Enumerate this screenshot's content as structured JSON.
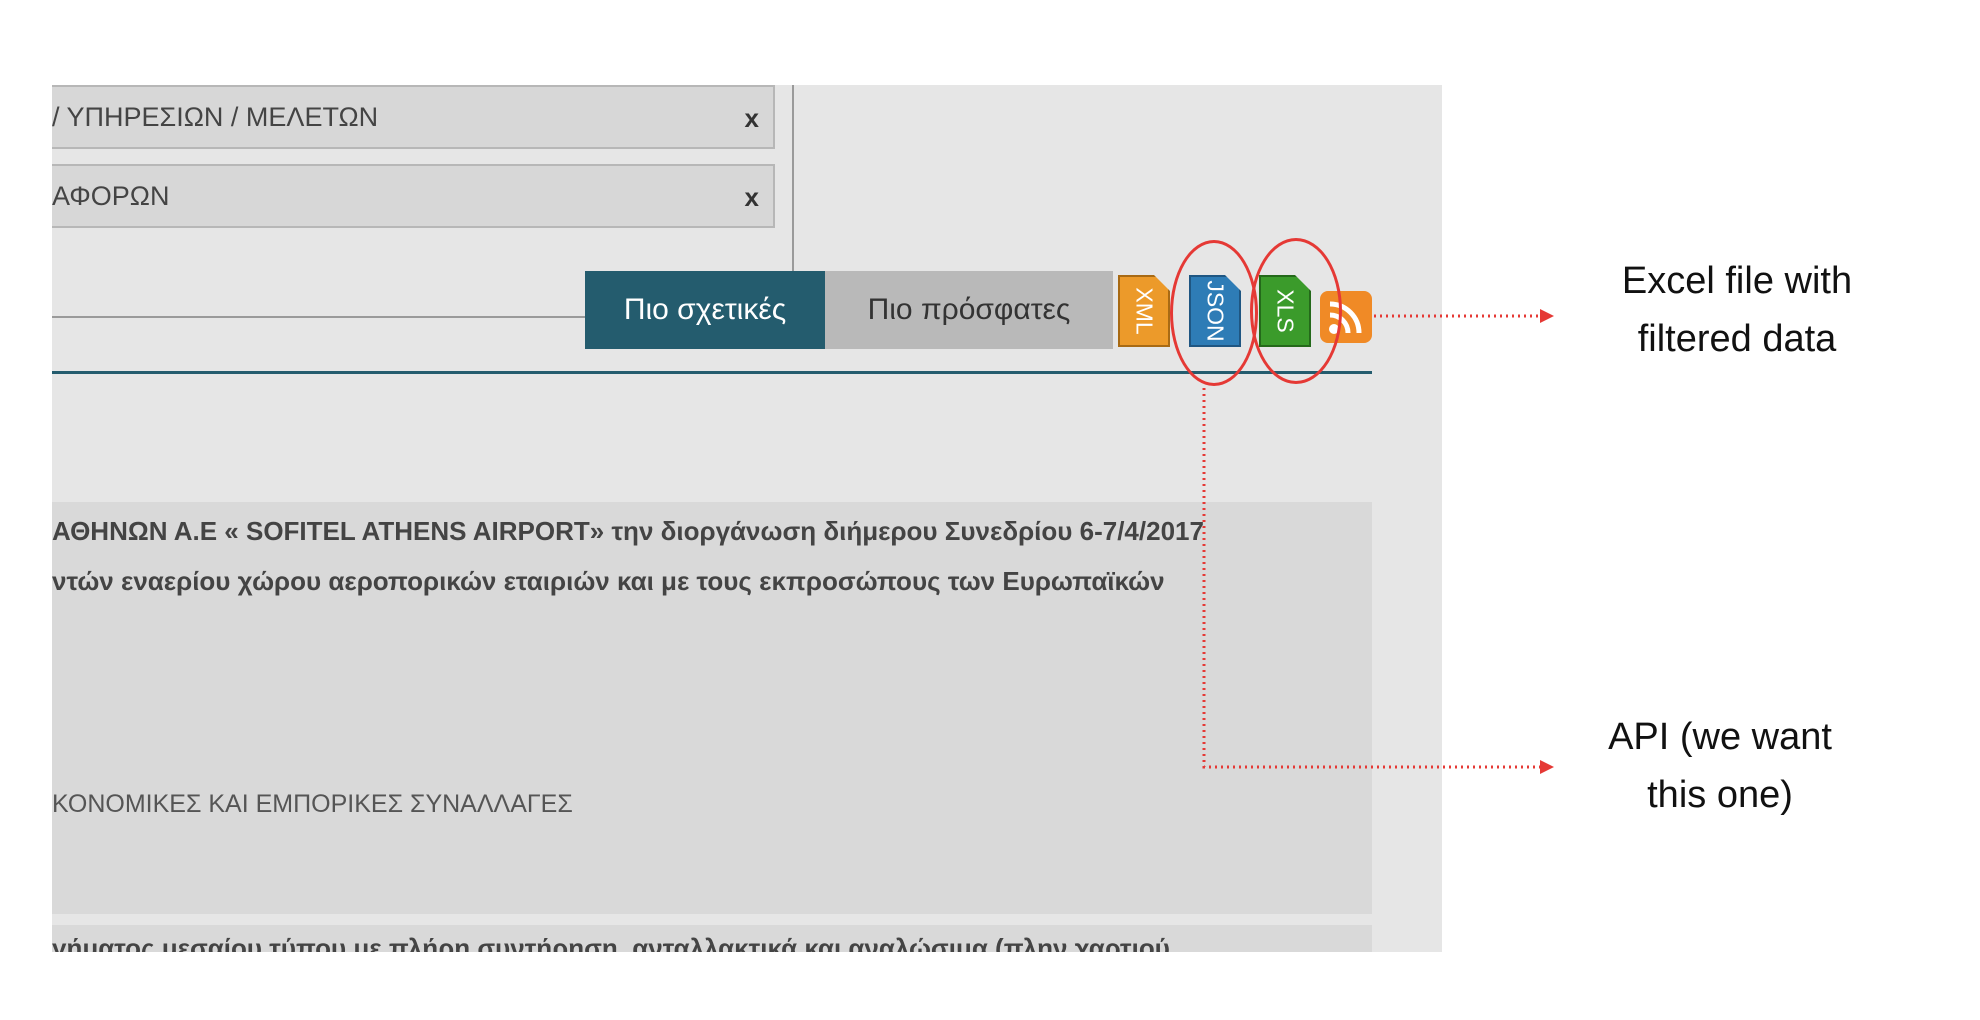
{
  "filters": {
    "chips": [
      {
        "label": "/ ΥΠΗΡΕΣΙΩΝ / ΜΕΛΕΤΩΝ",
        "remove": "x"
      },
      {
        "label": "ΑΦΟΡΩΝ",
        "remove": "x"
      }
    ]
  },
  "sort_tabs": {
    "active": "Πιο σχετικές",
    "inactive": "Πιο πρόσφατες"
  },
  "export_icons": {
    "xml": "XML",
    "json": "JSON",
    "xls": "XLS",
    "rss": "rss-icon"
  },
  "result": {
    "line1": "ΑΘΗΝΩΝ Α.Ε « SOFITEL ATHENS AIRPORT» την διοργάνωση διήμερου Συνεδρίου 6-7/4/2017",
    "line2": "ντών εναερίου χώρου αεροπορικών εταιριών και με τους εκπροσώπους των Ευρωπαϊκών",
    "category": "ΚΟΝΟΜΙΚΕΣ ΚΑΙ ΕΜΠΟΡΙΚΕΣ ΣΥΝΑΛΛΑΓΕΣ",
    "next_line": "γήματος μεσαίου τύπου με πλήρη συντήρηση, ανταλλακτικά και αναλώσιμα (πλην χαρτιού"
  },
  "annotations": {
    "excel_note": [
      "Excel file with",
      "filtered data"
    ],
    "api_note": [
      "API (we want",
      "this one)"
    ],
    "color": "#e53935"
  }
}
